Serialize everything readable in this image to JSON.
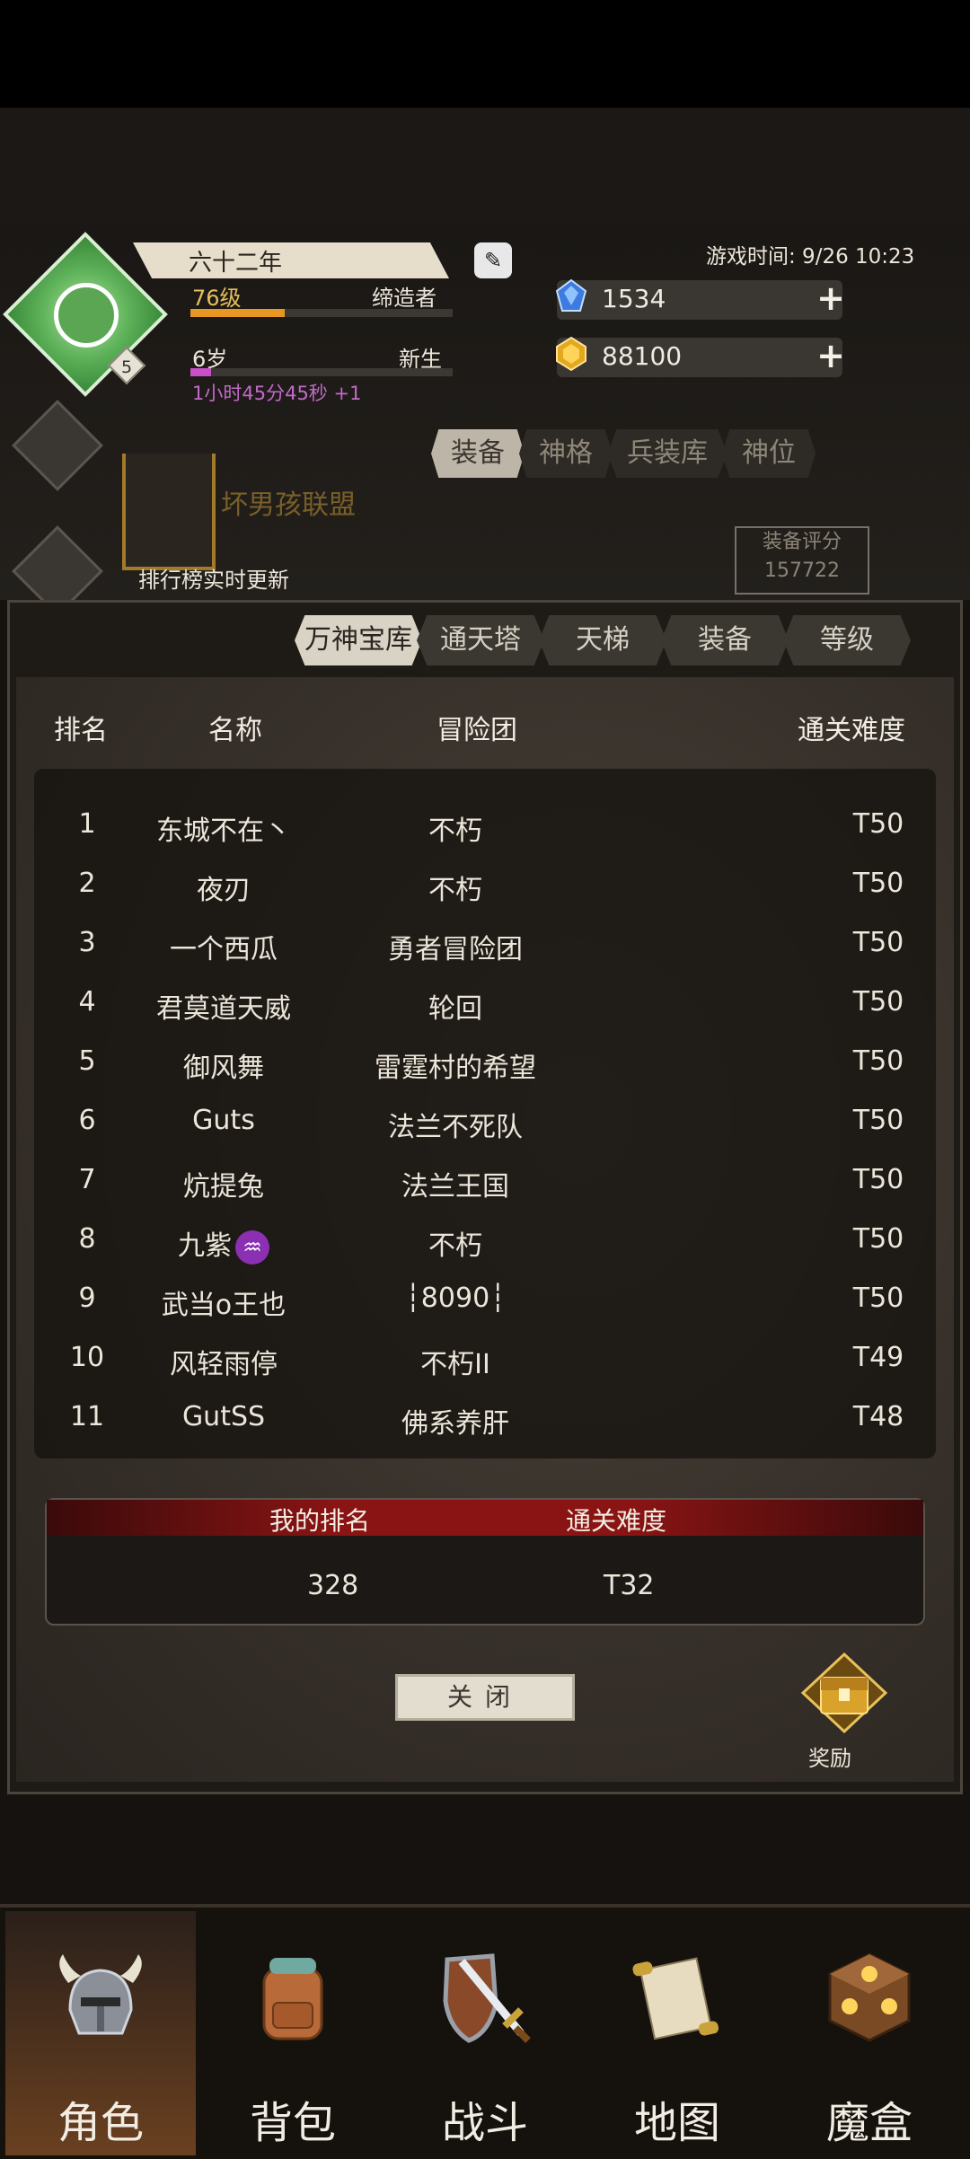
{
  "player": {
    "name": "六十二年",
    "emblem_badge": "5",
    "level": "76级",
    "class": "缔造者",
    "level_progress": 0.36,
    "age": "6岁",
    "stage": "新生",
    "age_progress": 0.08,
    "timer": "1小时45分45秒 +1",
    "edit_icon": "edit-icon"
  },
  "hud": {
    "game_time": "游戏时间: 9/26 10:23",
    "gems": "1534",
    "gold": "88100",
    "guild": "坏男孩联盟",
    "rank_note": "排行榜实时更新",
    "equip_score_label": "装备评分",
    "equip_score": "157722",
    "tabs": [
      "装备",
      "神格",
      "兵装库",
      "神位"
    ]
  },
  "ranking": {
    "tabs": [
      "万神宝库",
      "通天塔",
      "天梯",
      "装备",
      "等级"
    ],
    "headers": {
      "rank": "排名",
      "name": "名称",
      "team": "冒险团",
      "difficulty": "通关难度"
    },
    "rows": [
      {
        "rank": "1",
        "name": "东城不在丶",
        "team": "不朽",
        "difficulty": "T50"
      },
      {
        "rank": "2",
        "name": "夜刃",
        "team": "不朽",
        "difficulty": "T50"
      },
      {
        "rank": "3",
        "name": "一个西瓜",
        "team": "勇者冒险团",
        "difficulty": "T50"
      },
      {
        "rank": "4",
        "name": "君莫道天威",
        "team": "轮回",
        "difficulty": "T50"
      },
      {
        "rank": "5",
        "name": "御风舞",
        "team": "雷霆村的希望",
        "difficulty": "T50"
      },
      {
        "rank": "6",
        "name": "Guts",
        "team": "法兰不死队",
        "difficulty": "T50"
      },
      {
        "rank": "7",
        "name": "炕提兔",
        "team": "法兰王国",
        "difficulty": "T50"
      },
      {
        "rank": "8",
        "name": "九紫",
        "team": "不朽",
        "difficulty": "T50"
      },
      {
        "rank": "9",
        "name": "武当o王也",
        "team": "┆8090┆",
        "difficulty": "T50"
      },
      {
        "rank": "10",
        "name": "风轻雨停",
        "team": "不朽II",
        "difficulty": "T49"
      },
      {
        "rank": "11",
        "name": "GutSS",
        "team": "佛系养肝",
        "difficulty": "T48"
      }
    ],
    "aquarius_glyph": "♒",
    "my": {
      "rank_label": "我的排名",
      "diff_label": "通关难度",
      "rank": "328",
      "difficulty": "T32"
    },
    "close": "关闭",
    "reward": "奖励"
  },
  "nav": {
    "items": [
      {
        "label": "角色",
        "icon": "helmet-icon"
      },
      {
        "label": "背包",
        "icon": "backpack-icon"
      },
      {
        "label": "战斗",
        "icon": "sword-shield-icon"
      },
      {
        "label": "地图",
        "icon": "scroll-map-icon"
      },
      {
        "label": "魔盒",
        "icon": "magic-box-icon"
      }
    ]
  },
  "colors": {
    "accent_gold": "#e6c05a",
    "xp_bar": "#e89822",
    "age_bar": "#c94fc8",
    "header_red": "#8a1414"
  }
}
